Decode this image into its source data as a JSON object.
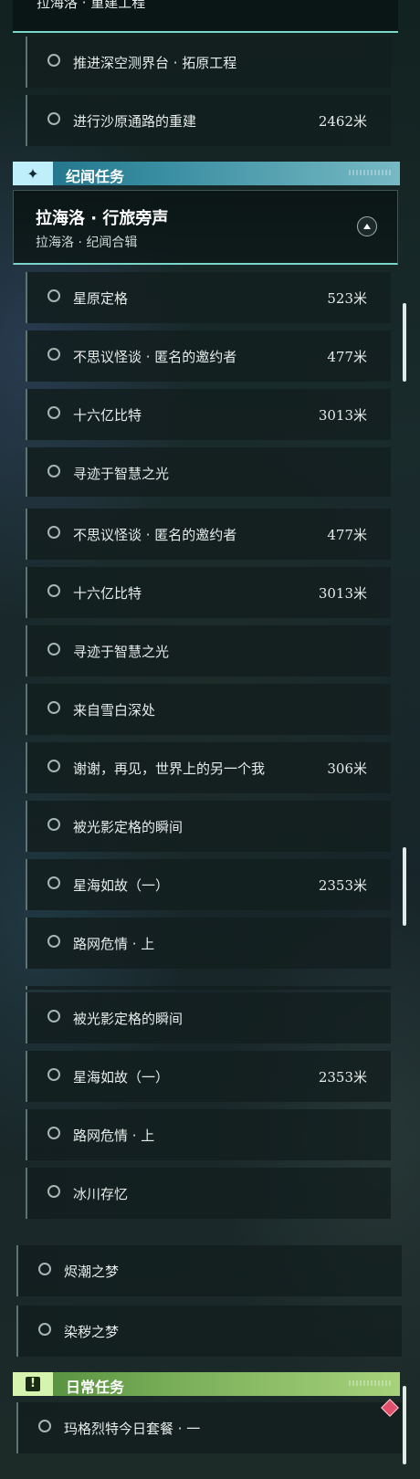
{
  "panel1": {
    "header_partial": "拉海洛 · 重建工程",
    "tasks_top": [
      {
        "title": "推进深空测界台 · 拓原工程",
        "distance": ""
      },
      {
        "title": "进行沙原通路的重建",
        "distance": "2462米"
      }
    ],
    "section": {
      "label": "纪闻任务",
      "icon": "sparkle-icon",
      "color": "#7fd3e6"
    },
    "group": {
      "title": "拉海洛 · 行旅旁声",
      "subtitle": "拉海洛 · 纪闻合辑"
    },
    "tasks": [
      {
        "title": "星原定格",
        "distance": "523米"
      },
      {
        "title": "不思议怪谈 · 匿名的邀约者",
        "distance": "477米"
      },
      {
        "title": "十六亿比特",
        "distance": "3013米"
      },
      {
        "title": "寻迹于智慧之光",
        "distance": ""
      }
    ]
  },
  "panel2": {
    "tasks": [
      {
        "title": "不思议怪谈 · 匿名的邀约者",
        "distance": "477米"
      },
      {
        "title": "十六亿比特",
        "distance": "3013米"
      },
      {
        "title": "寻迹于智慧之光",
        "distance": ""
      },
      {
        "title": "来自雪白深处",
        "distance": ""
      },
      {
        "title": "谢谢，再见，世界上的另一个我",
        "distance": "306米"
      },
      {
        "title": "被光影定格的瞬间",
        "distance": ""
      },
      {
        "title": "星海如故（一）",
        "distance": "2353米"
      },
      {
        "title": "路网危情 · 上",
        "distance": ""
      }
    ]
  },
  "panel3": {
    "tasks": [
      {
        "title": "被光影定格的瞬间",
        "distance": ""
      },
      {
        "title": "星海如故（一）",
        "distance": "2353米"
      },
      {
        "title": "路网危情 · 上",
        "distance": ""
      },
      {
        "title": "冰川存忆",
        "distance": ""
      }
    ],
    "standalone": [
      {
        "title": "烬潮之梦"
      },
      {
        "title": "染秽之梦"
      }
    ],
    "section": {
      "label": "日常任务",
      "icon": "exclamation-icon",
      "color": "#b9ea8a"
    },
    "daily": [
      {
        "title": "玛格烈特今日套餐 · 一"
      }
    ]
  }
}
